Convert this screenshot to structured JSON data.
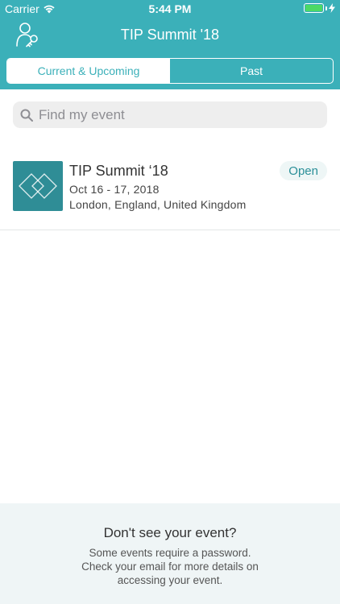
{
  "status_bar": {
    "carrier": "Carrier",
    "time": "5:44 PM"
  },
  "nav": {
    "title": "TIP Summit '18",
    "left_icon": "user-key-icon"
  },
  "tabs": [
    {
      "label": "Current & Upcoming",
      "active": true
    },
    {
      "label": "Past",
      "active": false
    }
  ],
  "search": {
    "placeholder": "Find my event"
  },
  "events": [
    {
      "title": "TIP Summit ‘18",
      "date": "Oct 16 - 17, 2018",
      "location": "London, England, United Kingdom",
      "status": "Open"
    }
  ],
  "footer": {
    "heading": "Don't see your event?",
    "text": "Some events require a password. Check your email for more details on accessing your event."
  },
  "colors": {
    "brand": "#3bb0b9",
    "logo_bg": "#2f8d96",
    "battery": "#4cd964"
  }
}
